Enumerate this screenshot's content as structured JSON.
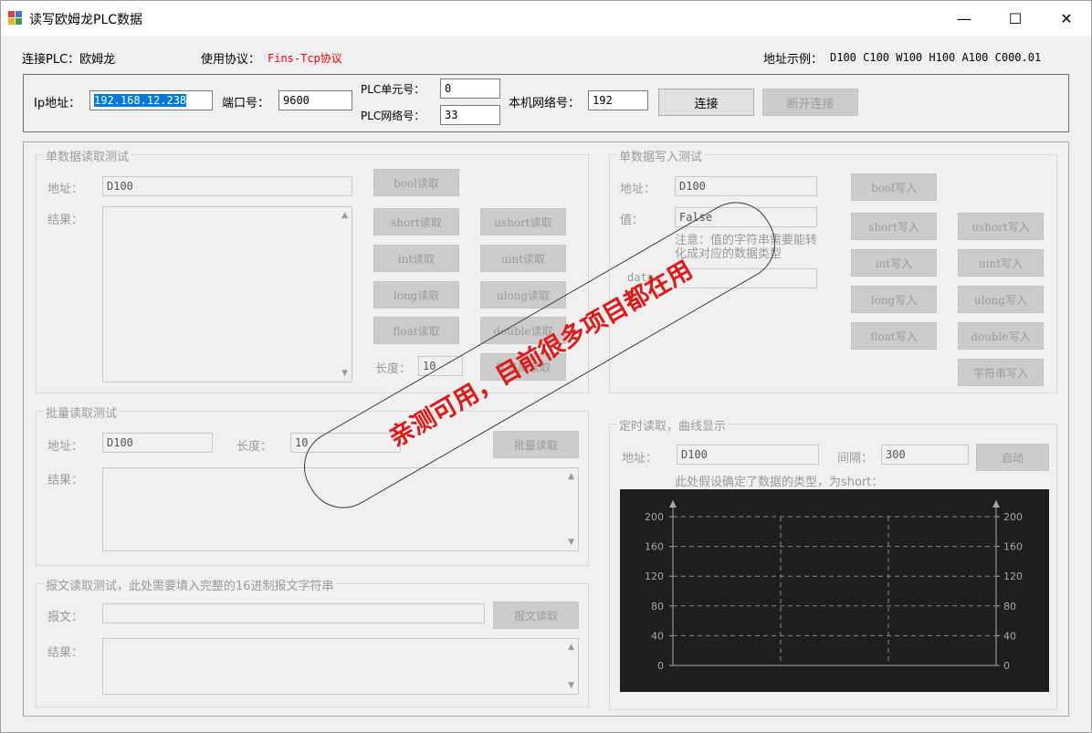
{
  "window": {
    "title": "读写欧姆龙PLC数据",
    "minimize_glyph": "—",
    "maximize_glyph": "☐",
    "close_glyph": "✕"
  },
  "header": {
    "plc_label": "连接PLC：",
    "plc_value": "欧姆龙",
    "protocol_label": "使用协议：",
    "protocol_value": "Fins-Tcp协议",
    "address_label": "地址示例：",
    "address_value": "D100 C100 W100 H100 A100 C000.01"
  },
  "connection": {
    "ip_label": "Ip地址：",
    "ip_value": "192.168.12.238",
    "port_label": "端口号：",
    "port_value": "9600",
    "unit_label": "PLC单元号：",
    "unit_value": "0",
    "net_label": "PLC网络号：",
    "net_value": "33",
    "local_net_label": "本机网络号：",
    "local_net_value": "192",
    "connect_button": "连接",
    "disconnect_button": "断开连接"
  },
  "single_read": {
    "title": "单数据读取测试",
    "address_label": "地址：",
    "address_value": "D100",
    "result_label": "结果：",
    "buttons": [
      "bool读取",
      "short读取",
      "ushort读取",
      "int读取",
      "uint读取",
      "long读取",
      "ulong读取",
      "float读取",
      "double读取"
    ],
    "length_label": "长度：",
    "length_value": "10",
    "string_button": "字符串读取"
  },
  "single_write": {
    "title": "单数据写入测试",
    "address_label": "地址：",
    "address_value": "D100",
    "value_label": "值：",
    "value_value": "False",
    "note": "注意：值的字符串需要能转化成对应的数据类型",
    "data_label": "data:",
    "buttons": [
      "bool写入",
      "short写入",
      "ushort写入",
      "int写入",
      "uint写入",
      "long写入",
      "ulong写入",
      "float写入",
      "double写入",
      "字符串写入"
    ]
  },
  "batch_read": {
    "title": "批量读取测试",
    "address_label": "地址：",
    "address_value": "D100",
    "length_label": "长度：",
    "length_value": "10",
    "button": "批量读取",
    "result_label": "结果："
  },
  "message_read": {
    "title": "报文读取测试，此处需要填入完整的16进制报文字符串",
    "message_label": "报文：",
    "message_value": "",
    "button": "报文读取",
    "result_label": "结果："
  },
  "timer_read": {
    "title": "定时读取，曲线显示",
    "address_label": "地址：",
    "address_value": "D100",
    "interval_label": "间隔：",
    "interval_value": "300",
    "start_button": "启动",
    "note": "此处假设确定了数据的类型，为short："
  },
  "chart_data": {
    "type": "line",
    "ylim": [
      0,
      200
    ],
    "yticks": [
      0,
      40,
      80,
      120,
      160,
      200
    ],
    "ytick_labels": [
      "0",
      "40",
      "80",
      "120",
      "160",
      "200"
    ],
    "series": [],
    "background": "#1e1e1e",
    "grid": true
  },
  "watermark": {
    "text": "亲测可用，目前很多项目都在用",
    "color": "#e01818"
  },
  "colors": {
    "protocol": "#ff0000",
    "selection": "#0078d7"
  }
}
